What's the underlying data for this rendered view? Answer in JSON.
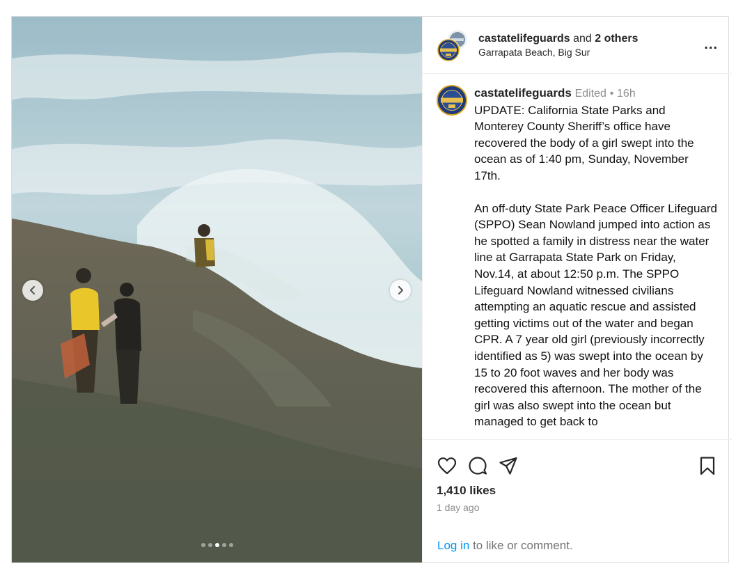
{
  "header": {
    "username": "castatelifeguards",
    "and_text": "and",
    "others": "2 others",
    "location": "Garrapata Beach, Big Sur",
    "more_label": "..."
  },
  "caption": {
    "username": "castatelifeguards",
    "edited": "Edited",
    "separator": "•",
    "time": "16h",
    "paragraph1": "UPDATE: California State Parks and Monterey County Sheriff’s office have recovered the body of a girl swept into the ocean as of 1:40 pm, Sunday, November 17th.",
    "paragraph2": "An off-duty State Park Peace Officer Lifeguard (SPPO) Sean Nowland jumped into action as he spotted a family in distress near the water line at Garrapata State Park on Friday, Nov.14, at about 12:50 p.m. The SPPO Lifeguard Nowland witnessed civilians attempting an aquatic rescue and assisted getting victims out of the water and began CPR. A 7 year old girl (previously incorrectly identified as 5) was swept into the ocean by 15 to 20 foot waves and her body was recovered this afternoon. The mother of the girl was also swept into the ocean but managed to get back to"
  },
  "avatar": {
    "badge_text_top": "CALIFORNIA",
    "badge_text_mid": "STATE LIFEGUARDS",
    "badge_number": "75"
  },
  "carousel": {
    "total_slides": 5,
    "active_slide": 3
  },
  "icons": {
    "prev": "chevron-left-icon",
    "next": "chevron-right-icon",
    "like": "heart-icon",
    "comment": "comment-icon",
    "share": "share-icon",
    "save": "bookmark-icon"
  },
  "stats": {
    "likes": "1,410 likes",
    "posted": "1 day ago"
  },
  "footer": {
    "login_link": "Log in",
    "login_rest": "to like or comment."
  },
  "colors": {
    "link": "#0095f6",
    "border": "#dbdbdb",
    "muted": "#8e8e8e"
  }
}
